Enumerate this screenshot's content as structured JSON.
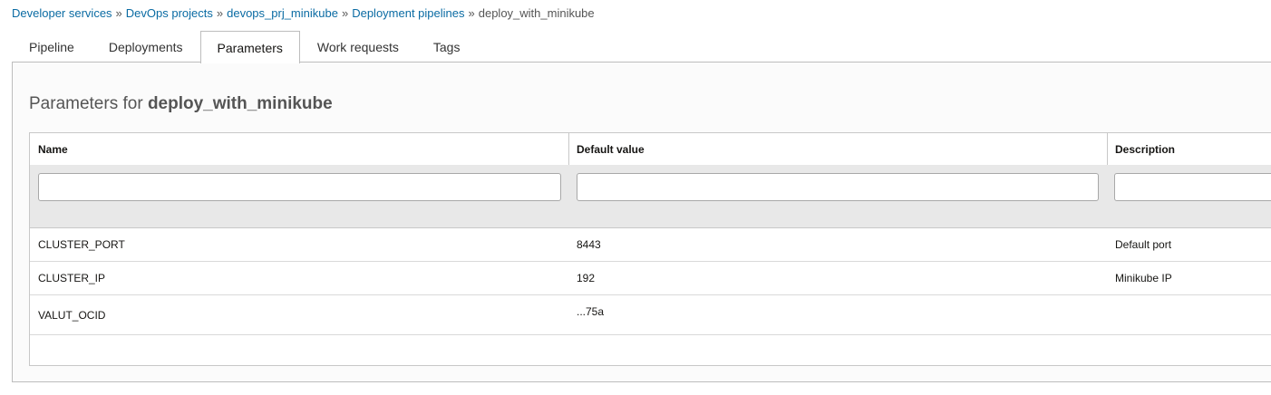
{
  "breadcrumb": {
    "items": [
      "Developer services",
      "DevOps projects",
      "devops_prj_minikube",
      "Deployment pipelines"
    ],
    "separator": "»",
    "current": "deploy_with_minikube"
  },
  "tabs": [
    {
      "label": "Pipeline",
      "active": false
    },
    {
      "label": "Deployments",
      "active": false
    },
    {
      "label": "Parameters",
      "active": true
    },
    {
      "label": "Work requests",
      "active": false
    },
    {
      "label": "Tags",
      "active": false
    }
  ],
  "heading": {
    "prefix": "Parameters for",
    "name": "deploy_with_minikube"
  },
  "table": {
    "columns": [
      "Name",
      "Default value",
      "Description"
    ],
    "filters": [
      "",
      "",
      ""
    ],
    "rows": [
      {
        "name": "CLUSTER_PORT",
        "default": "8443",
        "description": "Default port"
      },
      {
        "name": "CLUSTER_IP",
        "default": "192",
        "description": "Minikube IP"
      },
      {
        "name": "VALUT_OCID",
        "default": "...75a",
        "description": ""
      }
    ]
  },
  "colors": {
    "link": "#0a6ba3",
    "border": "#c8c8c8",
    "filter_band": "#e8e8e8"
  }
}
